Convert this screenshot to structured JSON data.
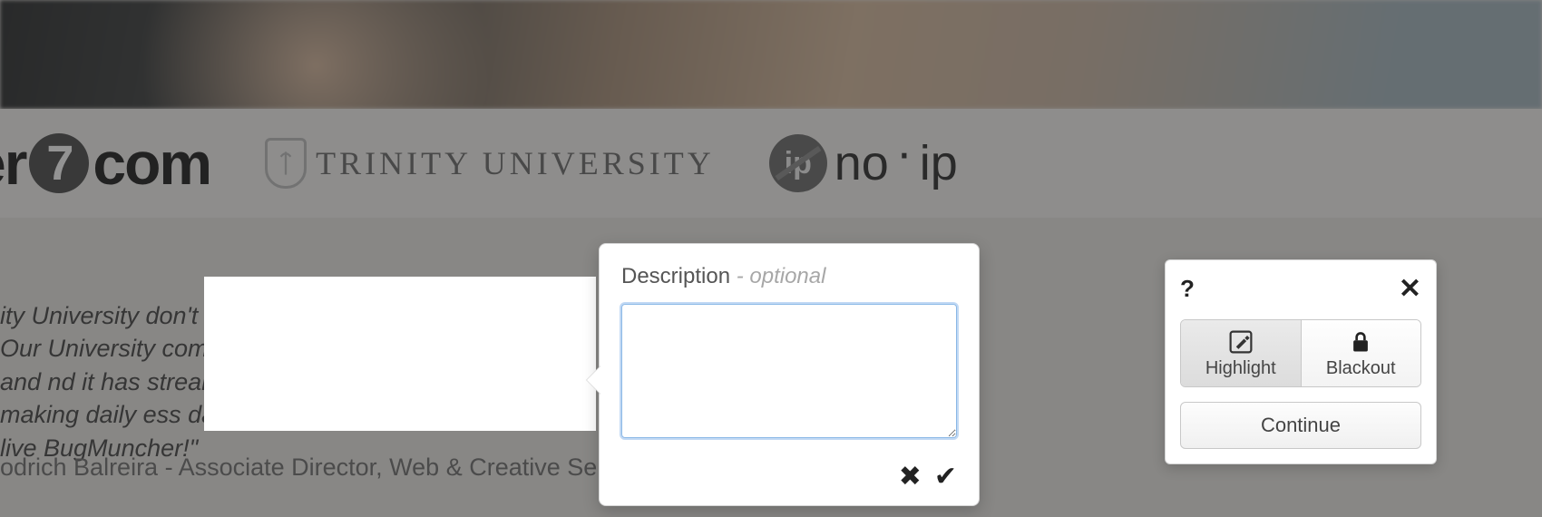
{
  "logos": {
    "partial7com_left": "er",
    "partial7com_seven": "7",
    "partial7com_right": "com",
    "trinity": "TRINITY UNIVERSITY",
    "noip_left": "no",
    "noip_right": "ip"
  },
  "testimonial": {
    "text": "ity University don't know what we would do without er! Our University community has embraced it for notes and nd it has streamlined our web ticketing system, making daily ess daunting and more efficient. Long live BugMuncher!\"",
    "author": "odrich Balreira - Associate Director, Web & Creative Services"
  },
  "popover": {
    "label": "Description",
    "optional": " - optional",
    "textarea_value": "",
    "textarea_placeholder": ""
  },
  "toolpanel": {
    "help": "?",
    "close": "✕",
    "highlight": "Highlight",
    "blackout": "Blackout",
    "continue": "Continue"
  }
}
